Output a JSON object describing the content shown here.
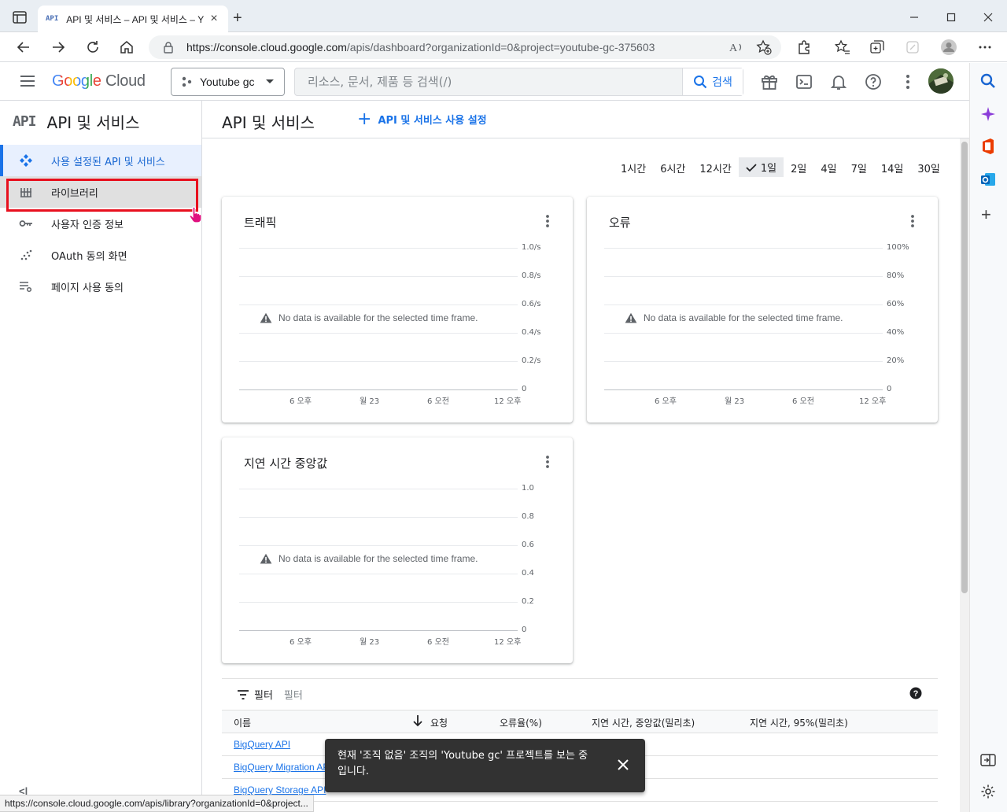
{
  "browser": {
    "tab_favicon": "API",
    "tab_title": "API 및 서비스 – API 및 서비스 – Y",
    "url_host": "https://console.cloud.google.com",
    "url_path": "/apis/dashboard?organizationId=0&project=youtube-gc-375603",
    "status_url": "https://console.cloud.google.com/apis/library?organizationId=0&project..."
  },
  "header": {
    "logo_google": "Google",
    "logo_cloud": "Cloud",
    "project_name": "Youtube gc",
    "search_placeholder": "리소스, 문서, 제품 등 검색(/)",
    "search_button": "검색"
  },
  "sidebar": {
    "header_icon": "API",
    "title": "API 및 서비스",
    "items": [
      {
        "label": "사용 설정된 API 및 서비스",
        "icon": "api-diamond-icon"
      },
      {
        "label": "라이브러리",
        "icon": "library-icon"
      },
      {
        "label": "사용자 인증 정보",
        "icon": "key-icon"
      },
      {
        "label": "OAuth 동의 화면",
        "icon": "consent-icon"
      },
      {
        "label": "페이지 사용 동의",
        "icon": "page-settings-icon"
      }
    ],
    "collapse_label": "<|"
  },
  "main": {
    "title": "API 및 서비스",
    "enable_link": "API 및 서비스 사용 설정",
    "time_ranges": [
      "1시간",
      "6시간",
      "12시간",
      "1일",
      "2일",
      "4일",
      "7일",
      "14일",
      "30일"
    ],
    "selected_time_range": "1일",
    "no_data": "No data is available for the selected time frame."
  },
  "charts": {
    "traffic": {
      "title": "트래픽",
      "yticks": [
        "1.0/s",
        "0.8/s",
        "0.6/s",
        "0.4/s",
        "0.2/s",
        "0"
      ],
      "xticks": [
        "6 오후",
        "월 23",
        "6 오전",
        "12 오후"
      ]
    },
    "errors": {
      "title": "오류",
      "yticks": [
        "100%",
        "80%",
        "60%",
        "40%",
        "20%",
        "0"
      ],
      "xticks": [
        "6 오후",
        "월 23",
        "6 오전",
        "12 오후"
      ]
    },
    "latency": {
      "title": "지연 시간 중앙값",
      "yticks": [
        "1.0",
        "0.8",
        "0.6",
        "0.4",
        "0.2",
        "0"
      ],
      "xticks": [
        "6 오후",
        "월 23",
        "6 오전",
        "12 오후"
      ]
    }
  },
  "table": {
    "filter_label": "필터",
    "filter_placeholder": "필터",
    "columns": [
      "이름",
      "요청",
      "오류율(%)",
      "지연 시간, 중앙값(밀리초)",
      "지연 시간, 95%(밀리초)"
    ],
    "rows": [
      "BigQuery API",
      "BigQuery Migration API",
      "BigQuery Storage API"
    ]
  },
  "snackbar": {
    "message": "현재 '조직 없음' 조직의 'Youtube gc' 프로젝트를 보는 중입니다."
  },
  "colors": {
    "accent": "#1a73e8",
    "highlight_box": "#e8101e",
    "snackbar_bg": "#323232"
  }
}
